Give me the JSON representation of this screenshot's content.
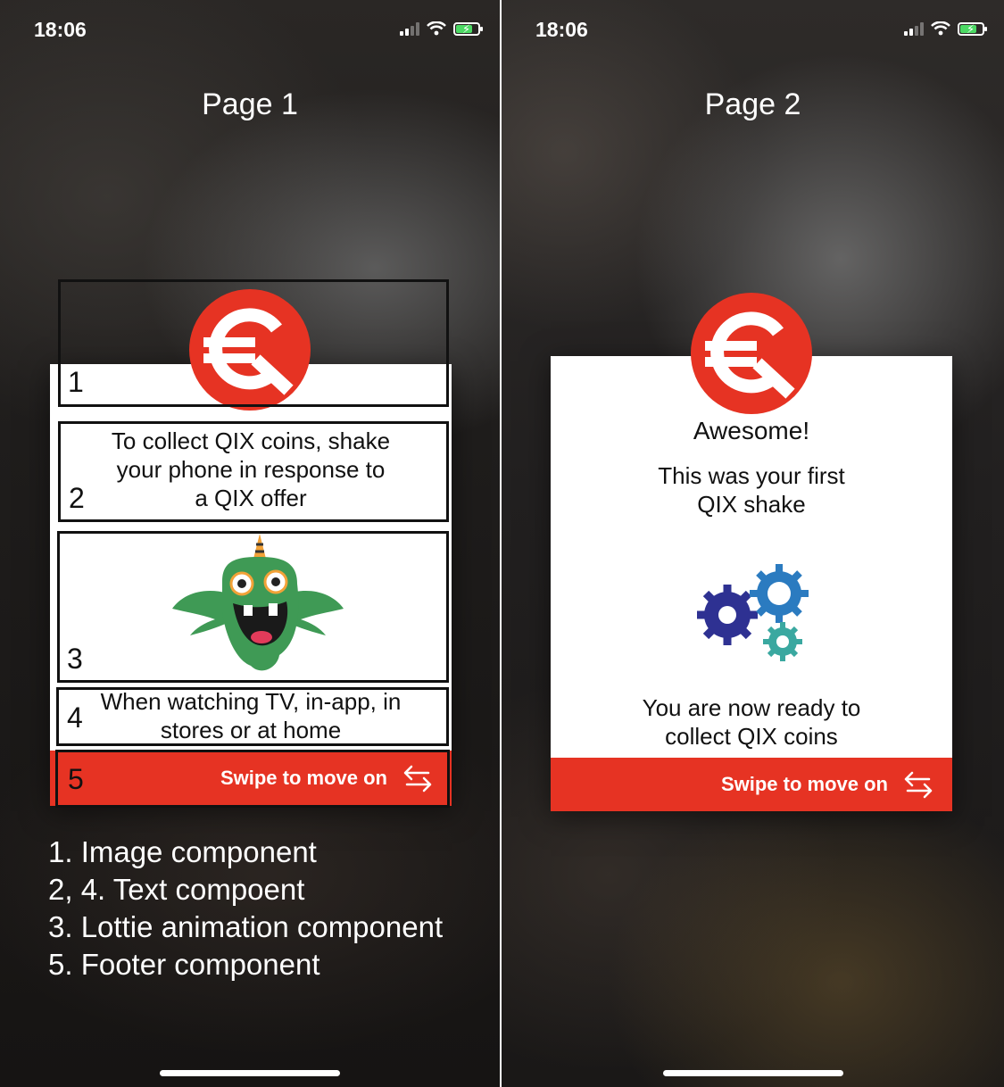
{
  "status_bar": {
    "time": "18:06"
  },
  "page1": {
    "title": "Page 1",
    "text_component_top": [
      "To collect QIX coins, shake",
      "your phone in response to",
      "a QIX offer"
    ],
    "text_component_bottom": [
      "When watching TV, in-app, in",
      "stores or at home"
    ],
    "footer_label": "Swipe to move on",
    "annotation_numbers": [
      "1",
      "2",
      "3",
      "4",
      "5"
    ],
    "legend": [
      "1. Image component",
      "2, 4. Text compoent",
      "3. Lottie animation component",
      "5. Footer component"
    ]
  },
  "page2": {
    "title": "Page 2",
    "heading": "Awesome!",
    "subtitle": [
      "This was your first",
      "QIX shake"
    ],
    "body": [
      "You are now ready to",
      "collect QIX coins"
    ],
    "footer_label": "Swipe to move on"
  },
  "colors": {
    "brand_red": "#e63323",
    "monster_green": "#3f9a55",
    "gear_dark_blue": "#2e3192",
    "gear_light_blue": "#2b7bc0",
    "gear_teal": "#3aa8a0"
  },
  "icons": [
    "signal-icon",
    "wifi-icon",
    "battery-icon",
    "qix-logo-icon",
    "monster-icon",
    "gears-icon",
    "swipe-arrows-icon"
  ]
}
